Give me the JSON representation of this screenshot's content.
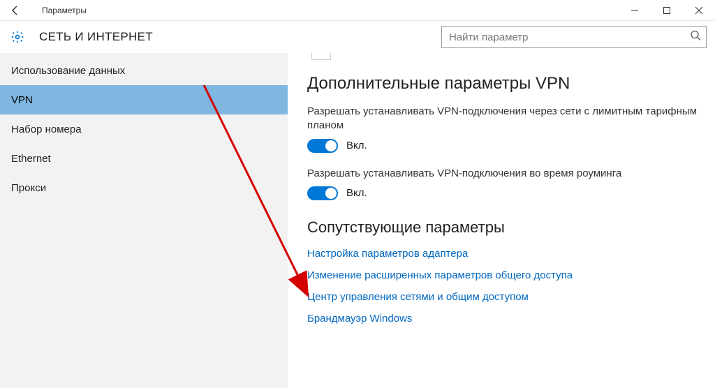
{
  "window": {
    "title": "Параметры"
  },
  "header": {
    "section": "СЕТЬ И ИНТЕРНЕТ",
    "search_placeholder": "Найти параметр"
  },
  "sidebar": {
    "items": [
      {
        "label": "Использование данных"
      },
      {
        "label": "VPN"
      },
      {
        "label": "Набор номера"
      },
      {
        "label": "Ethernet"
      },
      {
        "label": "Прокси"
      }
    ],
    "selected_index": 1
  },
  "content": {
    "heading": "Дополнительные параметры VPN",
    "settings": [
      {
        "text": "Разрешать устанавливать VPN-подключения через сети с лимитным тарифным планом",
        "state_label": "Вкл.",
        "on": true
      },
      {
        "text": "Разрешать устанавливать VPN-подключения во время роуминга",
        "state_label": "Вкл.",
        "on": true
      }
    ],
    "related_heading": "Сопутствующие параметры",
    "links": [
      "Настройка параметров адаптера",
      "Изменение расширенных параметров общего доступа",
      "Центр управления сетями и общим доступом",
      "Брандмауэр Windows"
    ]
  }
}
